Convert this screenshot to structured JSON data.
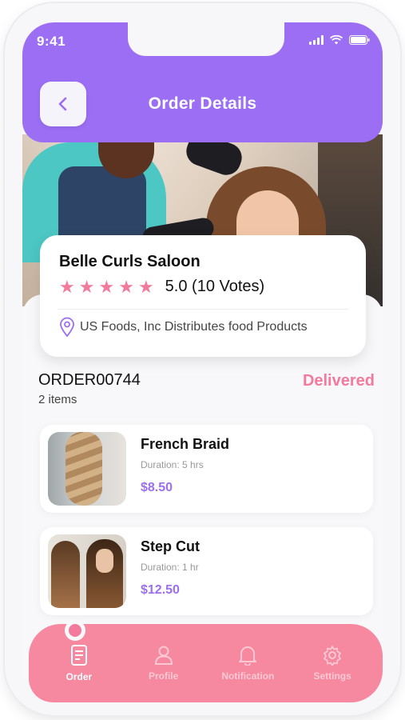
{
  "status_bar": {
    "time": "9:41"
  },
  "header": {
    "title": "Order Details"
  },
  "salon": {
    "name": "Belle Curls Saloon",
    "rating": "5.0 (10 Votes)",
    "stars": 5,
    "address": "US Foods, Inc Distributes food Products"
  },
  "order": {
    "id": "ORDER00744",
    "count": "2 items",
    "status": "Delivered"
  },
  "items": [
    {
      "name": "French Braid",
      "duration": "Duration: 5 hrs",
      "price": "$8.50"
    },
    {
      "name": "Step Cut",
      "duration": "Duration: 1 hr",
      "price": "$12.50"
    }
  ],
  "nav": [
    {
      "label": "Order",
      "icon": "order-icon",
      "active": true
    },
    {
      "label": "Profile",
      "icon": "profile-icon",
      "active": false
    },
    {
      "label": "Notification",
      "icon": "bell-icon",
      "active": false
    },
    {
      "label": "Settings",
      "icon": "gear-icon",
      "active": false
    }
  ],
  "colors": {
    "primary": "#9b6ef3",
    "accent": "#f27a9c",
    "nav_background": "#f6889f"
  }
}
